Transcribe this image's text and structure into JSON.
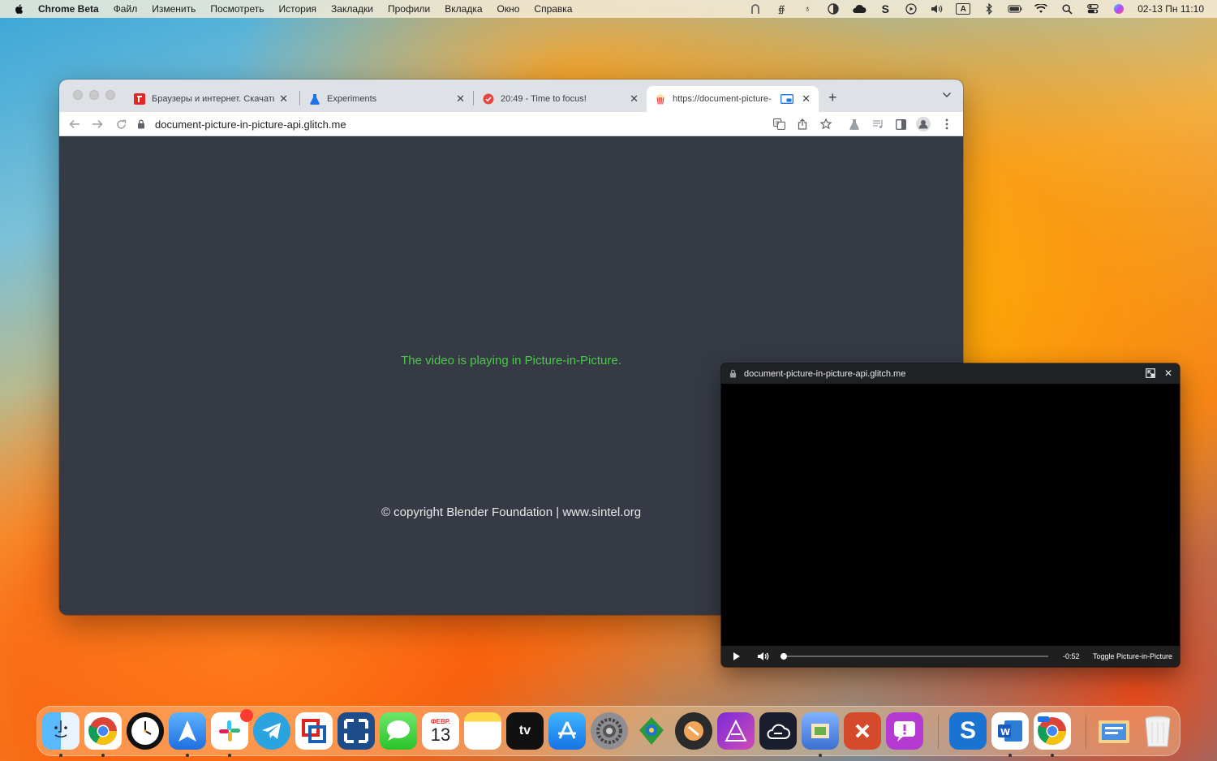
{
  "menubar": {
    "app_name": "Chrome Beta",
    "items": [
      "Файл",
      "Изменить",
      "Посмотреть",
      "История",
      "Закладки",
      "Профили",
      "Вкладка",
      "Окно",
      "Справка"
    ],
    "status_icons": [
      "vpn-icon",
      "script-icon",
      "figure-icon",
      "contrast-icon",
      "cloud-icon",
      "s-app-icon",
      "play-icon",
      "volume-icon",
      "input-source-icon",
      "bluetooth-icon",
      "battery-icon",
      "wifi-icon",
      "spotlight-icon",
      "control-center-icon",
      "siri-icon"
    ],
    "input_source": "A",
    "clock": "02-13 Пн  11:10"
  },
  "browser": {
    "tabs": [
      {
        "title": "Браузеры и интернет. Скачать",
        "favicon": "red-square"
      },
      {
        "title": "Experiments",
        "favicon": "flask"
      },
      {
        "title": "20:49 - Time to focus!",
        "favicon": "red-check"
      },
      {
        "title": "https://document-picture-",
        "favicon": "popcorn",
        "active": true
      }
    ],
    "address": "document-picture-in-picture-api.glitch.me",
    "content": {
      "pip_message": "The video is playing in Picture-in-Picture.",
      "copyright": "© copyright Blender Foundation | www.sintel.org"
    }
  },
  "pip_window": {
    "title": "document-picture-in-picture-api.glitch.me",
    "time_remaining": "-0:52",
    "toggle_label": "Toggle Picture-in-Picture",
    "progress": 0.0
  },
  "dock": {
    "apps": [
      "Finder",
      "Chrome",
      "Clock",
      "Spark",
      "Slack",
      "Telegram",
      "Parallels",
      "Screen Sharing",
      "Messages",
      "Calendar",
      "Notes",
      "Apple TV",
      "App Store",
      "System Settings",
      "Maps",
      "Sketchbook",
      "Affinity Photo",
      "Cloud",
      "Preview",
      "Remote Desktop",
      "Feedback",
      "Skitch",
      "Word",
      "Chrome Beta",
      "Downloads",
      "Trash"
    ],
    "calendar_month": "ФЕВР.",
    "calendar_day": "13",
    "word_letter": "W",
    "tv_label": "tv"
  }
}
